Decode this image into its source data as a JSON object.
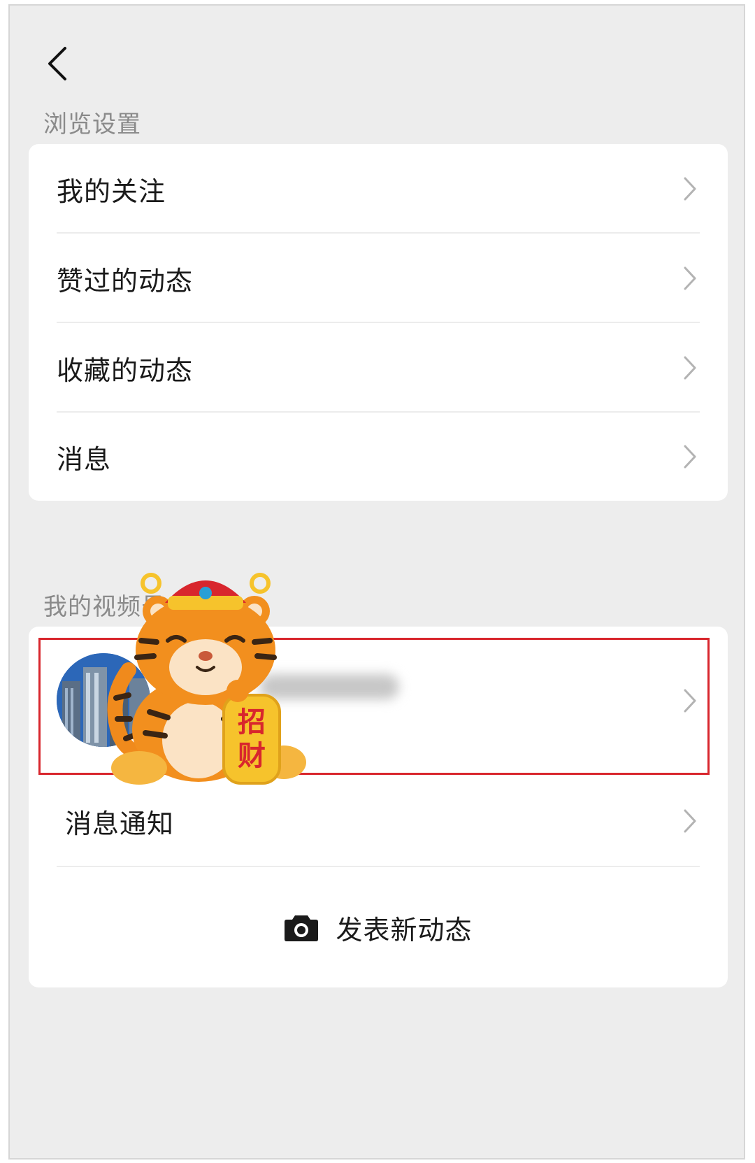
{
  "browse_section": {
    "title": "浏览设置",
    "items": [
      {
        "label": "我的关注",
        "icon": "chevron-right-icon"
      },
      {
        "label": "赞过的动态",
        "icon": "chevron-right-icon"
      },
      {
        "label": "收藏的动态",
        "icon": "chevron-right-icon"
      },
      {
        "label": "消息",
        "icon": "chevron-right-icon"
      }
    ]
  },
  "channel_section": {
    "title": "我的视频号",
    "account_row": {
      "icon": "chevron-right-icon"
    },
    "notify_label": "消息通知",
    "publish_label": "发表新动态",
    "publish_icon": "camera-icon"
  },
  "sticker": {
    "text_top": "招",
    "text_bottom": "财"
  },
  "colors": {
    "background": "#ededed",
    "card": "#ffffff",
    "highlight_border": "#d8262d",
    "chevron": "#b3b3b3",
    "section_title": "#8a8a8a"
  }
}
